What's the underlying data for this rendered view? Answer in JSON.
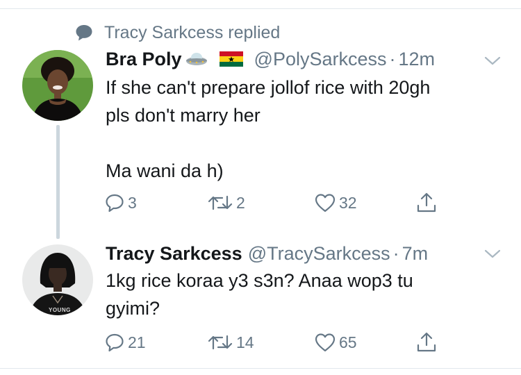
{
  "context": {
    "label": "Tracy Sarkcess replied"
  },
  "tweets": [
    {
      "name": "Bra Poly",
      "handle": "@PolySarkcess",
      "separator": "·",
      "time": "12m",
      "text": "If she can't prepare jollof rice  with 20gh\npls don't marry her\n\nMa wani da h)",
      "emoji": [
        "ufo-icon",
        "ghana-flag-icon"
      ],
      "replies": "3",
      "retweets": "2",
      "likes": "32"
    },
    {
      "name": "Tracy Sarkcess",
      "handle": "@TracySarkcess",
      "separator": "·",
      "time": "7m",
      "text": "1kg rice koraa y3 s3n? Anaa wop3 tu\ngyimi?",
      "avatar_caption": "YOUNG",
      "replies": "21",
      "retweets": "14",
      "likes": "65"
    }
  ],
  "colors": {
    "text": "#14171a",
    "muted": "#657786",
    "divider": "#e1e8ed",
    "thread_line": "#ccd6dd",
    "flag_red": "#ce1126",
    "flag_gold": "#fcd116",
    "flag_green": "#006b3f"
  }
}
